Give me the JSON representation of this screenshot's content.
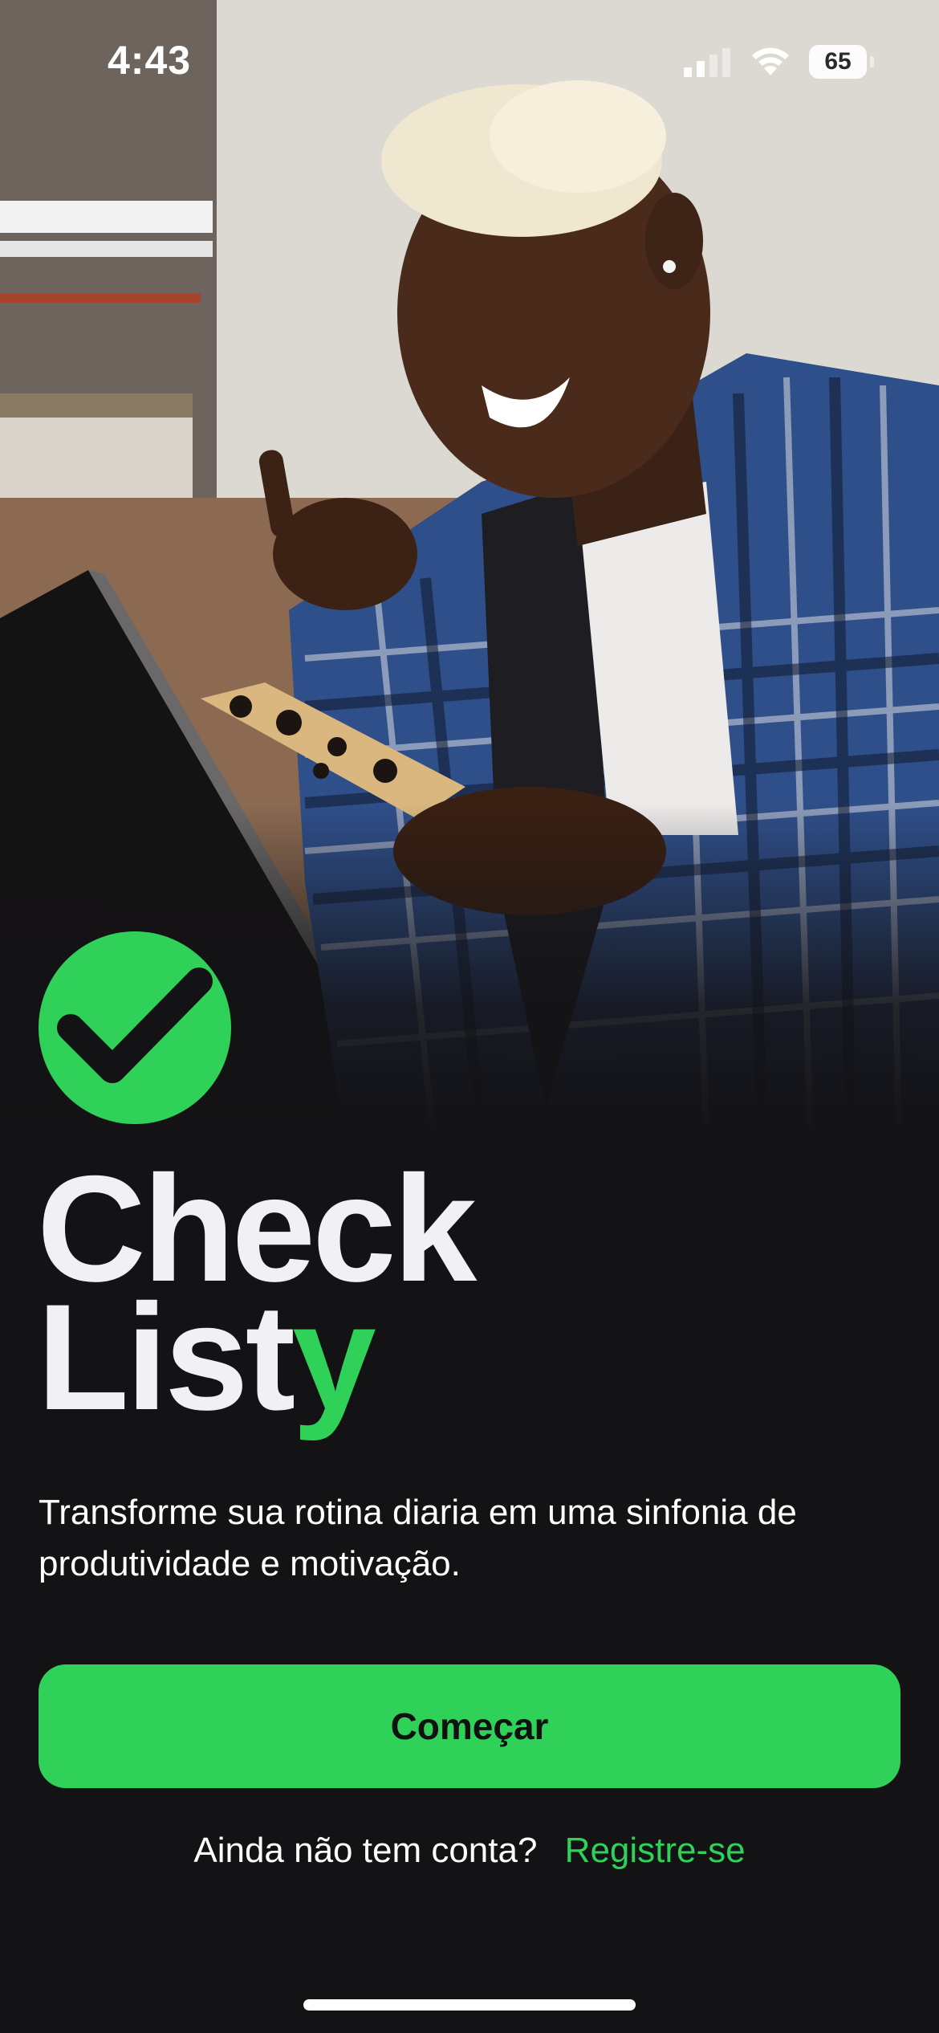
{
  "status_bar": {
    "time": "4:43",
    "battery": "65",
    "icons": [
      "cellular-signal-icon",
      "wifi-icon",
      "battery-icon"
    ]
  },
  "hero": {
    "image": "photo-person-holding-phone-smiling"
  },
  "brand": {
    "logo_icon": "checkmark-circle-icon",
    "title_line1": "Check",
    "title_line2_main": "List",
    "title_line2_accent": "y",
    "accent_color": "#2fd159"
  },
  "tagline": "Transforme sua rotina diaria em uma sinfonia de produtividade e motivação.",
  "actions": {
    "start_label": "Começar",
    "signup_question": "Ainda não tem conta?",
    "signup_link": "Registre-se"
  },
  "colors": {
    "background": "#131214",
    "primary": "#2fd159",
    "text": "#ffffff"
  }
}
